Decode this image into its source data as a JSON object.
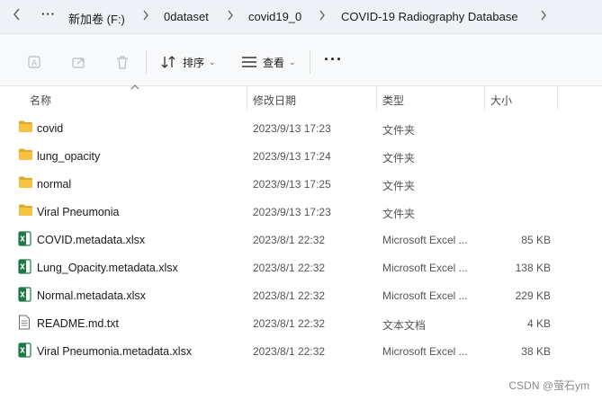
{
  "breadcrumb": {
    "more": "···",
    "items": [
      "新加卷 (F:)",
      "0dataset",
      "covid19_0",
      "COVID-19 Radiography Database"
    ]
  },
  "toolbar": {
    "sort_label": "排序",
    "view_label": "查看",
    "more_label": "···"
  },
  "columns": {
    "name": "名称",
    "date": "修改日期",
    "type": "类型",
    "size": "大小"
  },
  "files": [
    {
      "name": "covid",
      "date": "2023/9/13 17:23",
      "type": "文件夹",
      "size": "",
      "kind": "folder"
    },
    {
      "name": "lung_opacity",
      "date": "2023/9/13 17:24",
      "type": "文件夹",
      "size": "",
      "kind": "folder"
    },
    {
      "name": "normal",
      "date": "2023/9/13 17:25",
      "type": "文件夹",
      "size": "",
      "kind": "folder"
    },
    {
      "name": "Viral Pneumonia",
      "date": "2023/9/13 17:23",
      "type": "文件夹",
      "size": "",
      "kind": "folder"
    },
    {
      "name": "COVID.metadata.xlsx",
      "date": "2023/8/1 22:32",
      "type": "Microsoft Excel ...",
      "size": "85 KB",
      "kind": "excel"
    },
    {
      "name": "Lung_Opacity.metadata.xlsx",
      "date": "2023/8/1 22:32",
      "type": "Microsoft Excel ...",
      "size": "138 KB",
      "kind": "excel"
    },
    {
      "name": "Normal.metadata.xlsx",
      "date": "2023/8/1 22:32",
      "type": "Microsoft Excel ...",
      "size": "229 KB",
      "kind": "excel"
    },
    {
      "name": "README.md.txt",
      "date": "2023/8/1 22:32",
      "type": "文本文档",
      "size": "4 KB",
      "kind": "text"
    },
    {
      "name": "Viral Pneumonia.metadata.xlsx",
      "date": "2023/8/1 22:32",
      "type": "Microsoft Excel ...",
      "size": "38 KB",
      "kind": "excel"
    }
  ],
  "watermark": "CSDN @萤石ym",
  "colors": {
    "folder": "#f6c244",
    "folder_dark": "#e3a82a",
    "excel": "#1e7a45",
    "addr_bg": "#eef2f7"
  }
}
